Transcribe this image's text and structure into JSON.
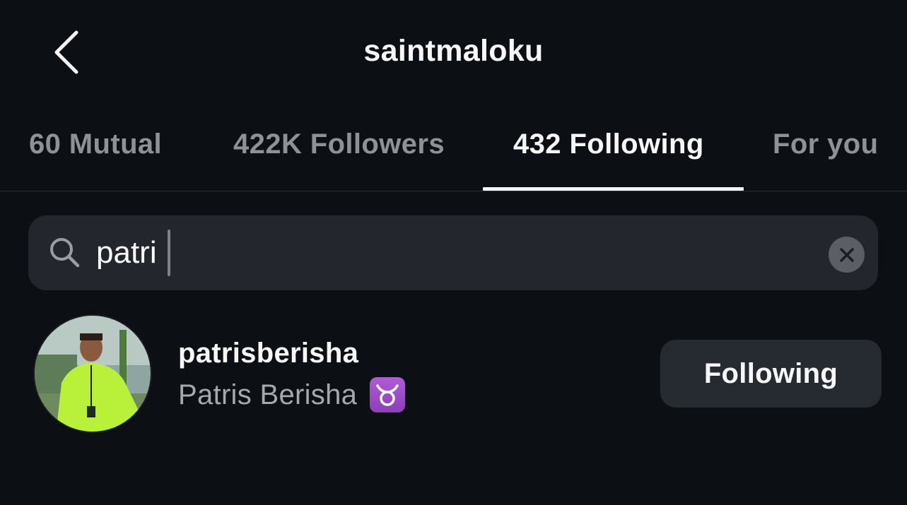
{
  "header": {
    "title": "saintmaloku",
    "back_icon": "chevron-left-icon"
  },
  "tabs": [
    {
      "label": "60 Mutual",
      "active": false
    },
    {
      "label": "422K Followers",
      "active": false
    },
    {
      "label": "432 Following",
      "active": true
    },
    {
      "label": "For you",
      "active": false
    }
  ],
  "search": {
    "value": "patri",
    "icon": "search-icon",
    "clear_icon": "close-icon"
  },
  "results": [
    {
      "username": "patrisberisha",
      "full_name": "Patris Berisha",
      "emoji": "taurus-icon",
      "button_label": "Following"
    }
  ],
  "colors": {
    "background": "#0c0f14",
    "search_bg": "#23262d",
    "button_bg": "#262a31",
    "inactive_tab": "#8e9197",
    "zodiac_purple": "#9b4cc7"
  }
}
